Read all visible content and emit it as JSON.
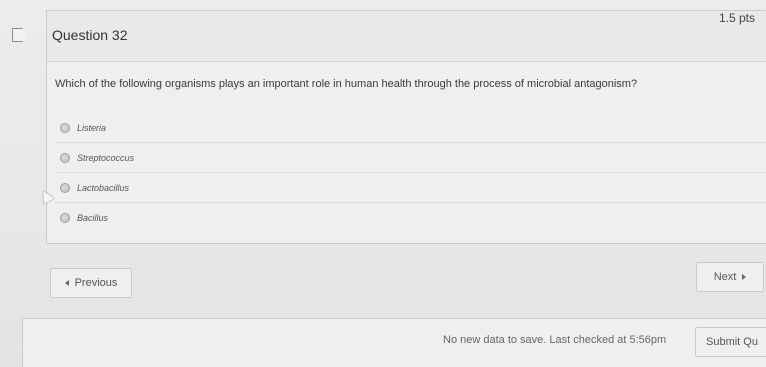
{
  "question": {
    "title": "Question 32",
    "points": "1.5 pts",
    "prompt": "Which of the following organisms plays an important role in human health through the process of microbial antagonism?",
    "answers": [
      {
        "label": "Listeria"
      },
      {
        "label": "Streptococcus"
      },
      {
        "label": "Lactobacillus"
      },
      {
        "label": "Bacillus"
      }
    ]
  },
  "nav": {
    "previous_label": "Previous",
    "next_label": "Next"
  },
  "footer": {
    "status": "No new data to save. Last checked at 5:56pm",
    "submit_label": "Submit Qu"
  }
}
